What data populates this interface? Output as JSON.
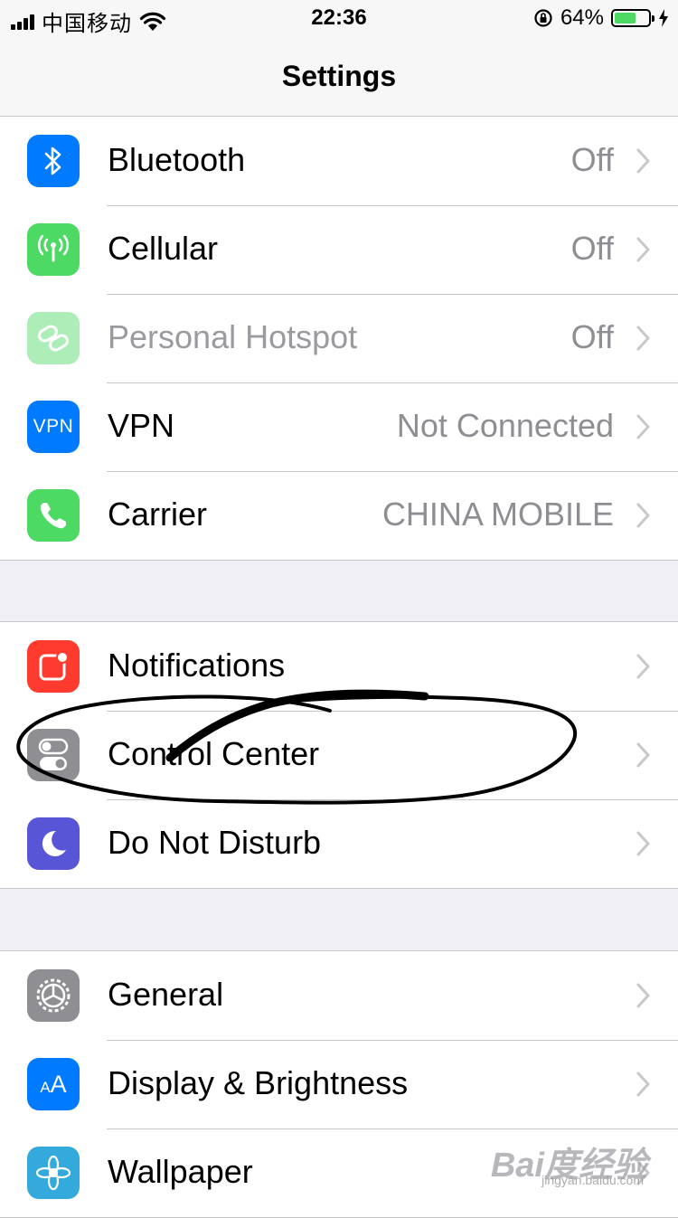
{
  "status_bar": {
    "carrier": "中国移动",
    "time": "22:36",
    "battery_percent": "64%",
    "battery_level": 0.64,
    "icons": [
      "signal-icon",
      "wifi-icon",
      "orientation-lock-icon",
      "battery-icon",
      "charging-icon"
    ]
  },
  "nav": {
    "title": "Settings"
  },
  "groups": [
    {
      "items": [
        {
          "label": "Bluetooth",
          "value": "Off",
          "icon": "bluetooth-icon",
          "color": "#007aff"
        },
        {
          "label": "Cellular",
          "value": "Off",
          "icon": "cellular-icon",
          "color": "#4cd964"
        },
        {
          "label": "Personal Hotspot",
          "value": "Off",
          "icon": "hotspot-icon",
          "color": "#4cd964",
          "disabled": true
        },
        {
          "label": "VPN",
          "value": "Not Connected",
          "icon": "vpn-icon",
          "icon_text": "VPN",
          "color": "#007aff"
        },
        {
          "label": "Carrier",
          "value": "CHINA MOBILE",
          "icon": "phone-icon",
          "color": "#4cd964"
        }
      ]
    },
    {
      "items": [
        {
          "label": "Notifications",
          "icon": "notifications-icon",
          "color": "#ff3b30"
        },
        {
          "label": "Control Center",
          "icon": "control-center-icon",
          "color": "#8e8e93"
        },
        {
          "label": "Do Not Disturb",
          "icon": "moon-icon",
          "color": "#5856d6"
        }
      ]
    },
    {
      "items": [
        {
          "label": "General",
          "icon": "gear-icon",
          "color": "#8e8e93"
        },
        {
          "label": "Display & Brightness",
          "icon": "display-icon",
          "icon_text": "AA",
          "color": "#007aff"
        },
        {
          "label": "Wallpaper",
          "icon": "wallpaper-icon",
          "color": "#34aadc"
        }
      ]
    }
  ],
  "watermark": {
    "text": "Bai度经验",
    "sub": "jingyan.baidu.com"
  },
  "annotation": {
    "shape": "hand-drawn ellipse",
    "target": "Control Center",
    "color": "#000000"
  }
}
